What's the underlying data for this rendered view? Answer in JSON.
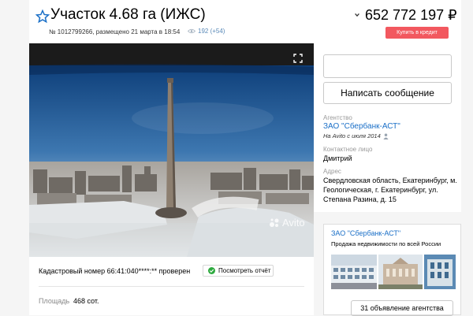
{
  "listing": {
    "title": "Участок 4.68 га (ИЖС)",
    "meta": "№ 1012799266, размещено 21 марта в 18:54",
    "views": "192 (+54)",
    "price": "652 772 197 ₽",
    "credit_label": "Купить в кредит"
  },
  "photo": {
    "watermark": "Avito"
  },
  "details": {
    "cadastral": "Кадастровый номер 66:41:040****:** проверен",
    "report_label": "Посмотреть отчёт",
    "area_label": "Площадь",
    "area_value": "468 сот."
  },
  "seller": {
    "message_label": "Написать сообщение",
    "agency_label": "Агентство",
    "agency_name": "ЗАО \"Сбербанк-АСТ\"",
    "since": "На Avito с июля 2014",
    "contact_label": "Контактное лицо",
    "contact_name": "Дмитрий",
    "address_label": "Адрес",
    "address": "Свердловская область, Екатеринбург, м. Геологическая, г. Екатеринбург, ул. Степана Разина, д. 15"
  },
  "agency_card": {
    "name": "ЗАО \"Сбербанк-АСТ\"",
    "description": "Продажа недвижимости по всей России",
    "button_label": "31 объявление агентства"
  },
  "colors": {
    "link": "#1a6fc7",
    "credit_button": "#f2585f",
    "verified": "#2eaa3f"
  }
}
